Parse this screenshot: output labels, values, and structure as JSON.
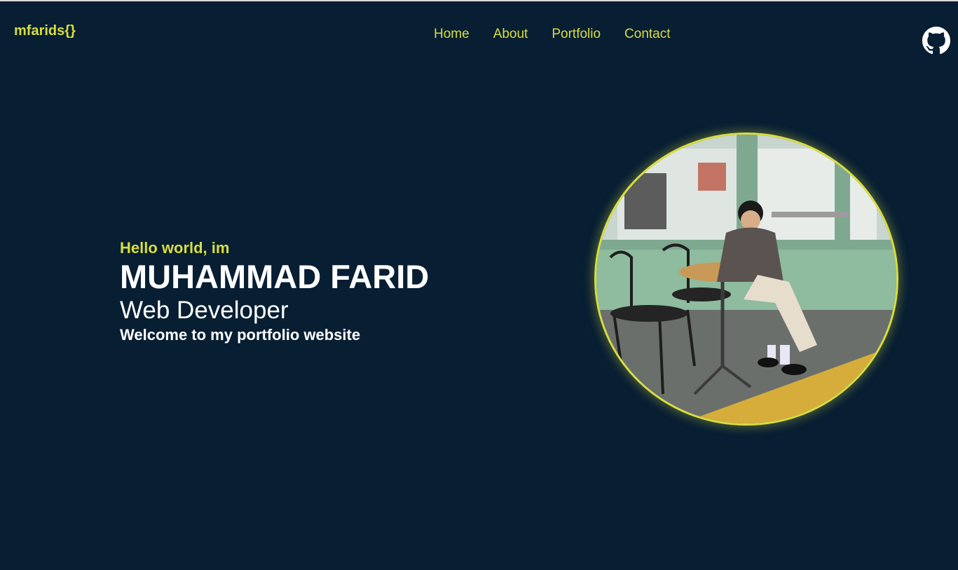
{
  "header": {
    "logo": "mfarids{}",
    "nav": [
      "Home",
      "About",
      "Portfolio",
      "Contact"
    ]
  },
  "hero": {
    "greeting": "Hello world, im",
    "name": "MUHAMMAD FARID",
    "role": "Web Developer",
    "welcome": "Welcome to my portfolio website"
  },
  "colors": {
    "background": "#071e33",
    "accent": "#d9de3e",
    "text": "#ffffff"
  },
  "icons": {
    "social": "github-icon"
  }
}
